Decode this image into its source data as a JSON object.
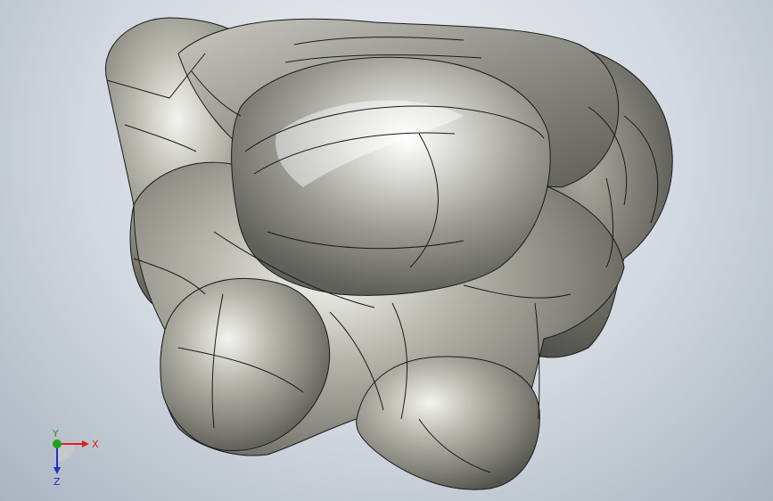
{
  "triad": {
    "x_label": "X",
    "y_label": "Y",
    "z_label": "Z",
    "x_color": "#e02020",
    "y_color": "#20a020",
    "z_color": "#2030c0"
  },
  "model": {
    "icon": "cad-part-icon",
    "surface_color": "#8d8d85",
    "highlight_color": "#ffffff",
    "edge_color": "#1a1a1a"
  }
}
